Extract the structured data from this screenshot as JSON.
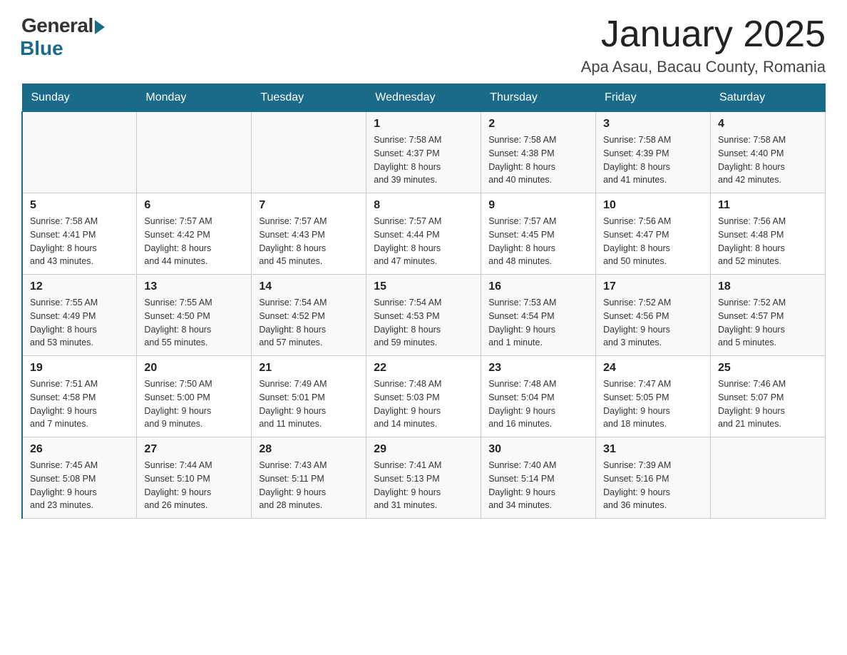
{
  "header": {
    "logo_general": "General",
    "logo_blue": "Blue",
    "month_title": "January 2025",
    "location": "Apa Asau, Bacau County, Romania"
  },
  "days_of_week": [
    "Sunday",
    "Monday",
    "Tuesday",
    "Wednesday",
    "Thursday",
    "Friday",
    "Saturday"
  ],
  "weeks": [
    [
      {
        "day": "",
        "info": ""
      },
      {
        "day": "",
        "info": ""
      },
      {
        "day": "",
        "info": ""
      },
      {
        "day": "1",
        "info": "Sunrise: 7:58 AM\nSunset: 4:37 PM\nDaylight: 8 hours\nand 39 minutes."
      },
      {
        "day": "2",
        "info": "Sunrise: 7:58 AM\nSunset: 4:38 PM\nDaylight: 8 hours\nand 40 minutes."
      },
      {
        "day": "3",
        "info": "Sunrise: 7:58 AM\nSunset: 4:39 PM\nDaylight: 8 hours\nand 41 minutes."
      },
      {
        "day": "4",
        "info": "Sunrise: 7:58 AM\nSunset: 4:40 PM\nDaylight: 8 hours\nand 42 minutes."
      }
    ],
    [
      {
        "day": "5",
        "info": "Sunrise: 7:58 AM\nSunset: 4:41 PM\nDaylight: 8 hours\nand 43 minutes."
      },
      {
        "day": "6",
        "info": "Sunrise: 7:57 AM\nSunset: 4:42 PM\nDaylight: 8 hours\nand 44 minutes."
      },
      {
        "day": "7",
        "info": "Sunrise: 7:57 AM\nSunset: 4:43 PM\nDaylight: 8 hours\nand 45 minutes."
      },
      {
        "day": "8",
        "info": "Sunrise: 7:57 AM\nSunset: 4:44 PM\nDaylight: 8 hours\nand 47 minutes."
      },
      {
        "day": "9",
        "info": "Sunrise: 7:57 AM\nSunset: 4:45 PM\nDaylight: 8 hours\nand 48 minutes."
      },
      {
        "day": "10",
        "info": "Sunrise: 7:56 AM\nSunset: 4:47 PM\nDaylight: 8 hours\nand 50 minutes."
      },
      {
        "day": "11",
        "info": "Sunrise: 7:56 AM\nSunset: 4:48 PM\nDaylight: 8 hours\nand 52 minutes."
      }
    ],
    [
      {
        "day": "12",
        "info": "Sunrise: 7:55 AM\nSunset: 4:49 PM\nDaylight: 8 hours\nand 53 minutes."
      },
      {
        "day": "13",
        "info": "Sunrise: 7:55 AM\nSunset: 4:50 PM\nDaylight: 8 hours\nand 55 minutes."
      },
      {
        "day": "14",
        "info": "Sunrise: 7:54 AM\nSunset: 4:52 PM\nDaylight: 8 hours\nand 57 minutes."
      },
      {
        "day": "15",
        "info": "Sunrise: 7:54 AM\nSunset: 4:53 PM\nDaylight: 8 hours\nand 59 minutes."
      },
      {
        "day": "16",
        "info": "Sunrise: 7:53 AM\nSunset: 4:54 PM\nDaylight: 9 hours\nand 1 minute."
      },
      {
        "day": "17",
        "info": "Sunrise: 7:52 AM\nSunset: 4:56 PM\nDaylight: 9 hours\nand 3 minutes."
      },
      {
        "day": "18",
        "info": "Sunrise: 7:52 AM\nSunset: 4:57 PM\nDaylight: 9 hours\nand 5 minutes."
      }
    ],
    [
      {
        "day": "19",
        "info": "Sunrise: 7:51 AM\nSunset: 4:58 PM\nDaylight: 9 hours\nand 7 minutes."
      },
      {
        "day": "20",
        "info": "Sunrise: 7:50 AM\nSunset: 5:00 PM\nDaylight: 9 hours\nand 9 minutes."
      },
      {
        "day": "21",
        "info": "Sunrise: 7:49 AM\nSunset: 5:01 PM\nDaylight: 9 hours\nand 11 minutes."
      },
      {
        "day": "22",
        "info": "Sunrise: 7:48 AM\nSunset: 5:03 PM\nDaylight: 9 hours\nand 14 minutes."
      },
      {
        "day": "23",
        "info": "Sunrise: 7:48 AM\nSunset: 5:04 PM\nDaylight: 9 hours\nand 16 minutes."
      },
      {
        "day": "24",
        "info": "Sunrise: 7:47 AM\nSunset: 5:05 PM\nDaylight: 9 hours\nand 18 minutes."
      },
      {
        "day": "25",
        "info": "Sunrise: 7:46 AM\nSunset: 5:07 PM\nDaylight: 9 hours\nand 21 minutes."
      }
    ],
    [
      {
        "day": "26",
        "info": "Sunrise: 7:45 AM\nSunset: 5:08 PM\nDaylight: 9 hours\nand 23 minutes."
      },
      {
        "day": "27",
        "info": "Sunrise: 7:44 AM\nSunset: 5:10 PM\nDaylight: 9 hours\nand 26 minutes."
      },
      {
        "day": "28",
        "info": "Sunrise: 7:43 AM\nSunset: 5:11 PM\nDaylight: 9 hours\nand 28 minutes."
      },
      {
        "day": "29",
        "info": "Sunrise: 7:41 AM\nSunset: 5:13 PM\nDaylight: 9 hours\nand 31 minutes."
      },
      {
        "day": "30",
        "info": "Sunrise: 7:40 AM\nSunset: 5:14 PM\nDaylight: 9 hours\nand 34 minutes."
      },
      {
        "day": "31",
        "info": "Sunrise: 7:39 AM\nSunset: 5:16 PM\nDaylight: 9 hours\nand 36 minutes."
      },
      {
        "day": "",
        "info": ""
      }
    ]
  ]
}
